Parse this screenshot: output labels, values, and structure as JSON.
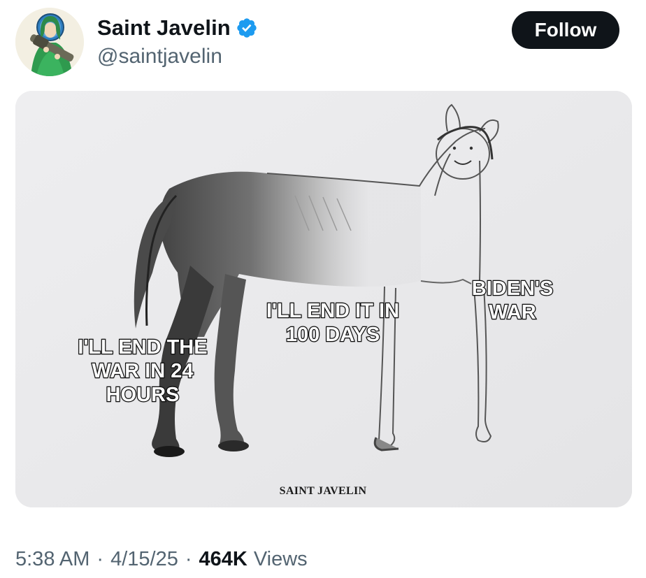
{
  "author": {
    "display_name": "Saint Javelin",
    "handle": "@saintjavelin",
    "verified": true,
    "avatar_icon": "saint-with-javelin-avatar"
  },
  "actions": {
    "follow_label": "Follow"
  },
  "media": {
    "description_icon": "half-drawn-horse-meme",
    "captions": [
      "I'LL END THE\nWAR IN 24\nHOURS",
      "I'LL END IT IN\n100 DAYS",
      "BIDEN'S\nWAR"
    ],
    "watermark": "SAINT JAVELIN"
  },
  "meta": {
    "time": "5:38 AM",
    "separator": "·",
    "date": "4/15/25",
    "views_count": "464K",
    "views_label": "Views"
  },
  "colors": {
    "verified_blue": "#1d9bf0",
    "follow_bg": "#0f1419",
    "secondary_text": "#536471"
  }
}
